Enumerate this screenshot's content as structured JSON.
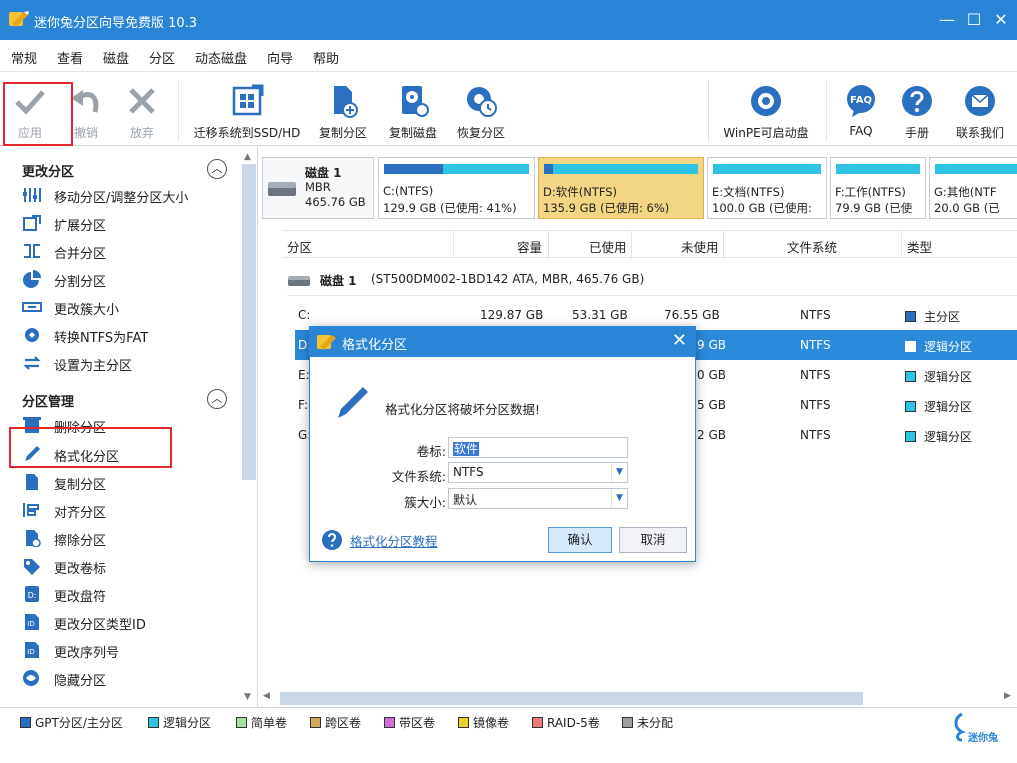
{
  "window": {
    "title": "迷你兔分区向导免费版 10.3",
    "min": "—",
    "max": "☐",
    "close": "✕"
  },
  "menu": [
    "常规",
    "查看",
    "磁盘",
    "分区",
    "动态磁盘",
    "向导",
    "帮助"
  ],
  "toolbar": {
    "apply": "应用",
    "undo": "撤销",
    "discard": "放弃",
    "migrate": "迁移系统到SSD/HD",
    "copy_partition": "复制分区",
    "copy_disk": "复制磁盘",
    "recover": "恢复分区",
    "winpe": "WinPE可启动盘",
    "faq": "FAQ",
    "manual": "手册",
    "contact": "联系我们",
    "faq_icon_text": "FAQ"
  },
  "sidebar": {
    "section1": "更改分区",
    "items1": [
      "移动分区/调整分区大小",
      "扩展分区",
      "合并分区",
      "分割分区",
      "更改簇大小",
      "转换NTFS为FAT",
      "设置为主分区"
    ],
    "section2": "分区管理",
    "items2": [
      "删除分区",
      "格式化分区",
      "复制分区",
      "对齐分区",
      "擦除分区",
      "更改卷标",
      "更改盘符",
      "更改分区类型ID",
      "更改序列号",
      "隐藏分区"
    ]
  },
  "disk": {
    "name": "磁盘 1",
    "type": "MBR",
    "size": "465.76 GB"
  },
  "partition_cards": [
    {
      "l1": "C:(NTFS)",
      "l2": "129.9 GB (已使用: 41%)"
    },
    {
      "l1": "D:软件(NTFS)",
      "l2": "135.9 GB (已使用: 6%)"
    },
    {
      "l1": "E:文档(NTFS)",
      "l2": "100.0 GB (已使用:"
    },
    {
      "l1": "F:工作(NTFS)",
      "l2": "79.9 GB (已使"
    },
    {
      "l1": "G:其他(NTF",
      "l2": "20.0 GB (已"
    }
  ],
  "table": {
    "headers": [
      "分区",
      "容量",
      "已使用",
      "未使用",
      "文件系统",
      "类型"
    ],
    "disk_row_name": "磁盘 1",
    "disk_row_detail": "(ST500DM002-1BD142 ATA, MBR, 465.76 GB)",
    "rows": [
      {
        "name": "C:",
        "cap": "129.87 GB",
        "used": "53.31 GB",
        "free": "76.55 GB",
        "fs": "NTFS",
        "type": "主分区"
      },
      {
        "name": "D:",
        "cap": "",
        "used": "",
        "free": "9 GB",
        "fs": "NTFS",
        "type": "逻辑分区"
      },
      {
        "name": "E:",
        "cap": "",
        "used": "",
        "free": "0 GB",
        "fs": "NTFS",
        "type": "逻辑分区"
      },
      {
        "name": "F:",
        "cap": "",
        "used": "",
        "free": "5 GB",
        "fs": "NTFS",
        "type": "逻辑分区"
      },
      {
        "name": "G:",
        "cap": "",
        "used": "",
        "free": "2 GB",
        "fs": "NTFS",
        "type": "逻辑分区"
      }
    ]
  },
  "legend": [
    "GPT分区/主分区",
    "逻辑分区",
    "简单卷",
    "跨区卷",
    "带区卷",
    "镜像卷",
    "RAID-5卷",
    "未分配"
  ],
  "legend_colors": [
    "#2a6fc0",
    "#2fc4e4",
    "#a6e0a0",
    "#d4a85a",
    "#cf6fd6",
    "#e7d12a",
    "#f07a7a",
    "#9e9e9e"
  ],
  "brand": "迷你兔",
  "dialog": {
    "title": "格式化分区",
    "warning": "格式化分区将破坏分区数据!",
    "label_volume": "卷标:",
    "volume_value": "软件",
    "label_fs": "文件系统:",
    "fs_value": "NTFS",
    "label_cluster": "簇大小:",
    "cluster_value": "默认",
    "help_link": "格式化分区教程",
    "ok": "确认",
    "cancel": "取消"
  },
  "colors": {
    "accent": "#2a85d6",
    "selected_row": "#2b8ad9",
    "selected_card": "#f3d583",
    "highlight_box": "#e0272e"
  }
}
